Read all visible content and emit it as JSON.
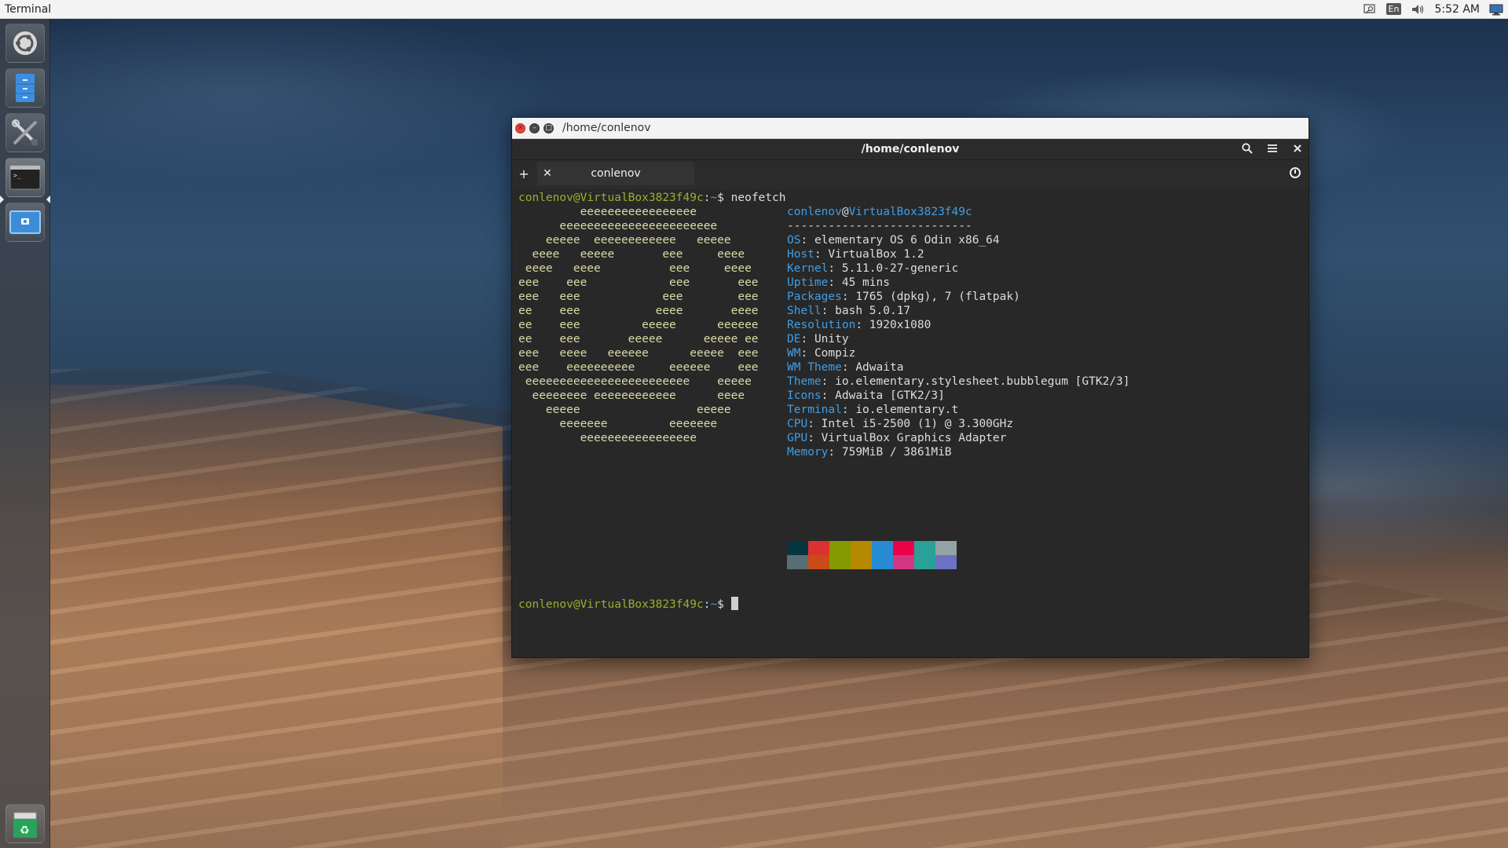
{
  "top_panel": {
    "app_title": "Terminal",
    "language": "En",
    "clock": "5:52 AM",
    "icons": [
      "search-icon",
      "language-icon",
      "volume-icon",
      "display-icon"
    ]
  },
  "launcher": {
    "items": [
      {
        "name": "ubuntu-logo-icon"
      },
      {
        "name": "file-manager-icon"
      },
      {
        "name": "system-settings-icon"
      },
      {
        "name": "terminal-icon"
      },
      {
        "name": "screenshot-icon"
      },
      {
        "name": "trash-icon"
      }
    ]
  },
  "window": {
    "wm_title": "/home/conlenov",
    "header_title": "/home/conlenov",
    "tab_label": "conlenov"
  },
  "terminal": {
    "prompt_user": "conlenov@VirtualBox3823f49c",
    "prompt_sep": ":",
    "prompt_path": "~",
    "prompt_end": "$",
    "command": "neofetch",
    "logo_lines": [
      "         eeeeeeeeeeeeeeeee",
      "      eeeeeeeeeeeeeeeeeeeeeee",
      "    eeeee  eeeeeeeeeeee   eeeee",
      "  eeee   eeeee       eee     eeee",
      " eeee   eeee          eee     eeee",
      "eee    eee            eee       eee",
      "eee   eee            eee        eee",
      "ee    eee           eeee       eeee",
      "ee    eee         eeeee      eeeeee",
      "ee    eee       eeeee      eeeee ee",
      "eee   eeee   eeeeee      eeeee  eee",
      "eee    eeeeeeeeee     eeeeee    eee",
      " eeeeeeeeeeeeeeeeeeeeeeee    eeeee",
      "  eeeeeeee eeeeeeeeeeee      eeee",
      "    eeeee                 eeeee",
      "      eeeeeee         eeeeeee",
      "         eeeeeeeeeeeeeeeee"
    ],
    "header_user": "conlenov",
    "header_at": "@",
    "header_host": "VirtualBox3823f49c",
    "separator": "---------------------------",
    "info": [
      {
        "key": "OS",
        "value": "elementary OS 6 Odin x86_64"
      },
      {
        "key": "Host",
        "value": "VirtualBox 1.2"
      },
      {
        "key": "Kernel",
        "value": "5.11.0-27-generic"
      },
      {
        "key": "Uptime",
        "value": "45 mins"
      },
      {
        "key": "Packages",
        "value": "1765 (dpkg), 7 (flatpak)"
      },
      {
        "key": "Shell",
        "value": "bash 5.0.17"
      },
      {
        "key": "Resolution",
        "value": "1920x1080"
      },
      {
        "key": "DE",
        "value": "Unity"
      },
      {
        "key": "WM",
        "value": "Compiz"
      },
      {
        "key": "WM Theme",
        "value": "Adwaita"
      },
      {
        "key": "Theme",
        "value": "io.elementary.stylesheet.bubblegum [GTK2/3]"
      },
      {
        "key": "Icons",
        "value": "Adwaita [GTK2/3]"
      },
      {
        "key": "Terminal",
        "value": "io.elementary.t"
      },
      {
        "key": "CPU",
        "value": "Intel i5-2500 (1) @ 3.300GHz"
      },
      {
        "key": "GPU",
        "value": "VirtualBox Graphics Adapter"
      },
      {
        "key": "Memory",
        "value": "759MiB / 3861MiB"
      }
    ],
    "palette_top": [
      "#073642",
      "#dc322f",
      "#859900",
      "#b58900",
      "#268bd2",
      "#ec0048",
      "#2aa198",
      "#94a3a5"
    ],
    "palette_bottom": [
      "#586e75",
      "#cb4b16",
      "#859900",
      "#b58900",
      "#268bd2",
      "#d33682",
      "#2aa198",
      "#6c71c4"
    ]
  }
}
